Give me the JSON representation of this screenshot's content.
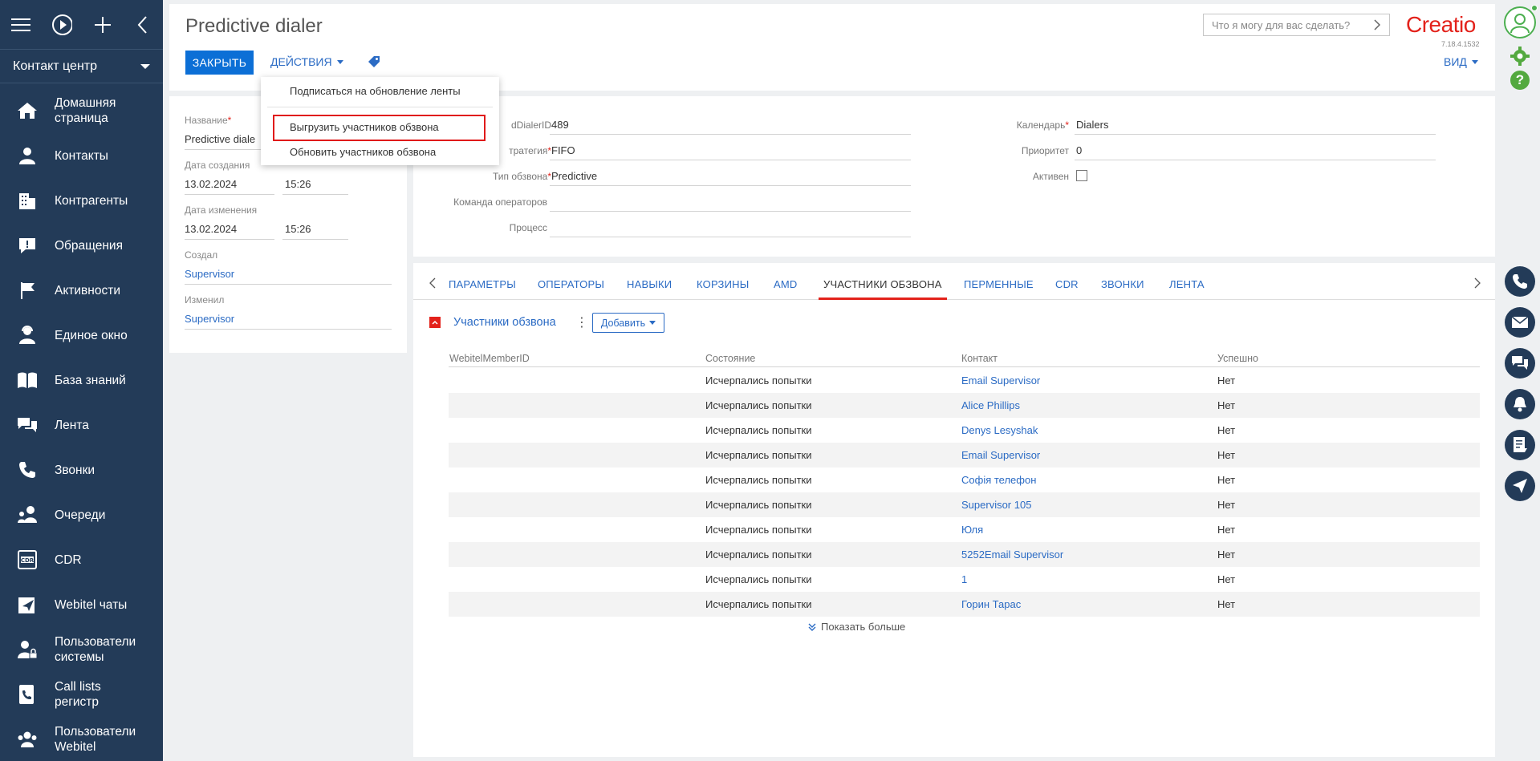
{
  "sidebar": {
    "section": "Контакт центр",
    "items": [
      {
        "label": "Домашняя страница",
        "icon": "home-icon"
      },
      {
        "label": "Контакты",
        "icon": "contact-icon"
      },
      {
        "label": "Контрагенты",
        "icon": "building-icon"
      },
      {
        "label": "Обращения",
        "icon": "case-icon"
      },
      {
        "label": "Активности",
        "icon": "flag-icon"
      },
      {
        "label": "Единое окно",
        "icon": "agent-icon"
      },
      {
        "label": "База знаний",
        "icon": "book-icon"
      },
      {
        "label": "Лента",
        "icon": "feed-icon"
      },
      {
        "label": "Звонки",
        "icon": "phone-icon"
      },
      {
        "label": "Очереди",
        "icon": "queue-icon"
      },
      {
        "label": "CDR",
        "icon": "cdr-icon"
      },
      {
        "label": "Webitel чаты",
        "icon": "send-icon"
      },
      {
        "label": "Пользователи системы",
        "icon": "user-lock-icon"
      },
      {
        "label": "Call lists регистр",
        "icon": "call-list-icon"
      },
      {
        "label": "Пользователи Webitel",
        "icon": "users-icon"
      }
    ]
  },
  "header": {
    "title": "Predictive dialer",
    "close_label": "ЗАКРЫТЬ",
    "actions_label": "ДЕЙСТВИЯ",
    "search_placeholder": "Что я могу для вас сделать?",
    "logo": "Creatio",
    "version": "7.18.4.1532",
    "view_label": "ВИД"
  },
  "actions_menu": {
    "items": [
      "Подписаться на обновление ленты",
      "Выгрузить участников обзвона",
      "Обновить участников обзвона"
    ]
  },
  "info": {
    "name_label": "Название",
    "name_value": "Predictive diale",
    "created_label": "Дата создания",
    "created_date": "13.02.2024",
    "created_time": "15:26",
    "modified_label": "Дата изменения",
    "modified_date": "13.02.2024",
    "modified_time": "15:26",
    "created_by_label": "Создал",
    "created_by": "Supervisor",
    "modified_by_label": "Изменил",
    "modified_by": "Supervisor"
  },
  "form": {
    "dialer_id_label": "dDialerID",
    "dialer_id_value": "489",
    "strategy_label": "тратегия",
    "strategy_value": "FIFO",
    "type_label": "Тип обзвона",
    "type_value": "Predictive",
    "team_label": "Команда операторов",
    "team_value": "",
    "process_label": "Процесс",
    "process_value": "",
    "calendar_label": "Календарь",
    "calendar_value": "Dialers",
    "priority_label": "Приоритет",
    "priority_value": "0",
    "active_label": "Активен"
  },
  "tabs": [
    "ПАРАМЕТРЫ",
    "ОПЕРАТОРЫ",
    "НАВЫКИ",
    "КОРЗИНЫ",
    "AMD",
    "УЧАСТНИКИ ОБЗВОНА",
    "ПЕРМЕННЫЕ",
    "CDR",
    "ЗВОНКИ",
    "ЛЕНТА"
  ],
  "grid": {
    "title": "Участники обзвона",
    "add_label": "Добавить",
    "columns": [
      "WebitelMemberID",
      "Состояние",
      "Контакт",
      "Успешно"
    ],
    "rows": [
      {
        "id": "",
        "state": "Исчерпались попытки",
        "contact": "Email Supervisor",
        "success": "Нет"
      },
      {
        "id": "",
        "state": "Исчерпались попытки",
        "contact": "Alice Phillips",
        "success": "Нет"
      },
      {
        "id": "",
        "state": "Исчерпались попытки",
        "contact": "Denys Lesyshak",
        "success": "Нет"
      },
      {
        "id": "",
        "state": "Исчерпались попытки",
        "contact": "Email Supervisor",
        "success": "Нет"
      },
      {
        "id": "",
        "state": "Исчерпались попытки",
        "contact": "Софія телефон",
        "success": "Нет"
      },
      {
        "id": "",
        "state": "Исчерпались попытки",
        "contact": "Supervisor 105",
        "success": "Нет"
      },
      {
        "id": "",
        "state": "Исчерпались попытки",
        "contact": "Юля",
        "success": "Нет"
      },
      {
        "id": "",
        "state": "Исчерпались попытки",
        "contact": "5252Email Supervisor",
        "success": "Нет"
      },
      {
        "id": "",
        "state": "Исчерпались попытки",
        "contact": "1",
        "success": "Нет"
      },
      {
        "id": "",
        "state": "Исчерпались попытки",
        "contact": "Горин Тарас",
        "success": "Нет"
      }
    ],
    "show_more": "Показать больше"
  },
  "colors": {
    "sidebar": "#233b58",
    "accent": "#0c6fd6",
    "link": "#2b6bc4",
    "brand": "#e3221b",
    "highlight": "#e01a1a"
  }
}
